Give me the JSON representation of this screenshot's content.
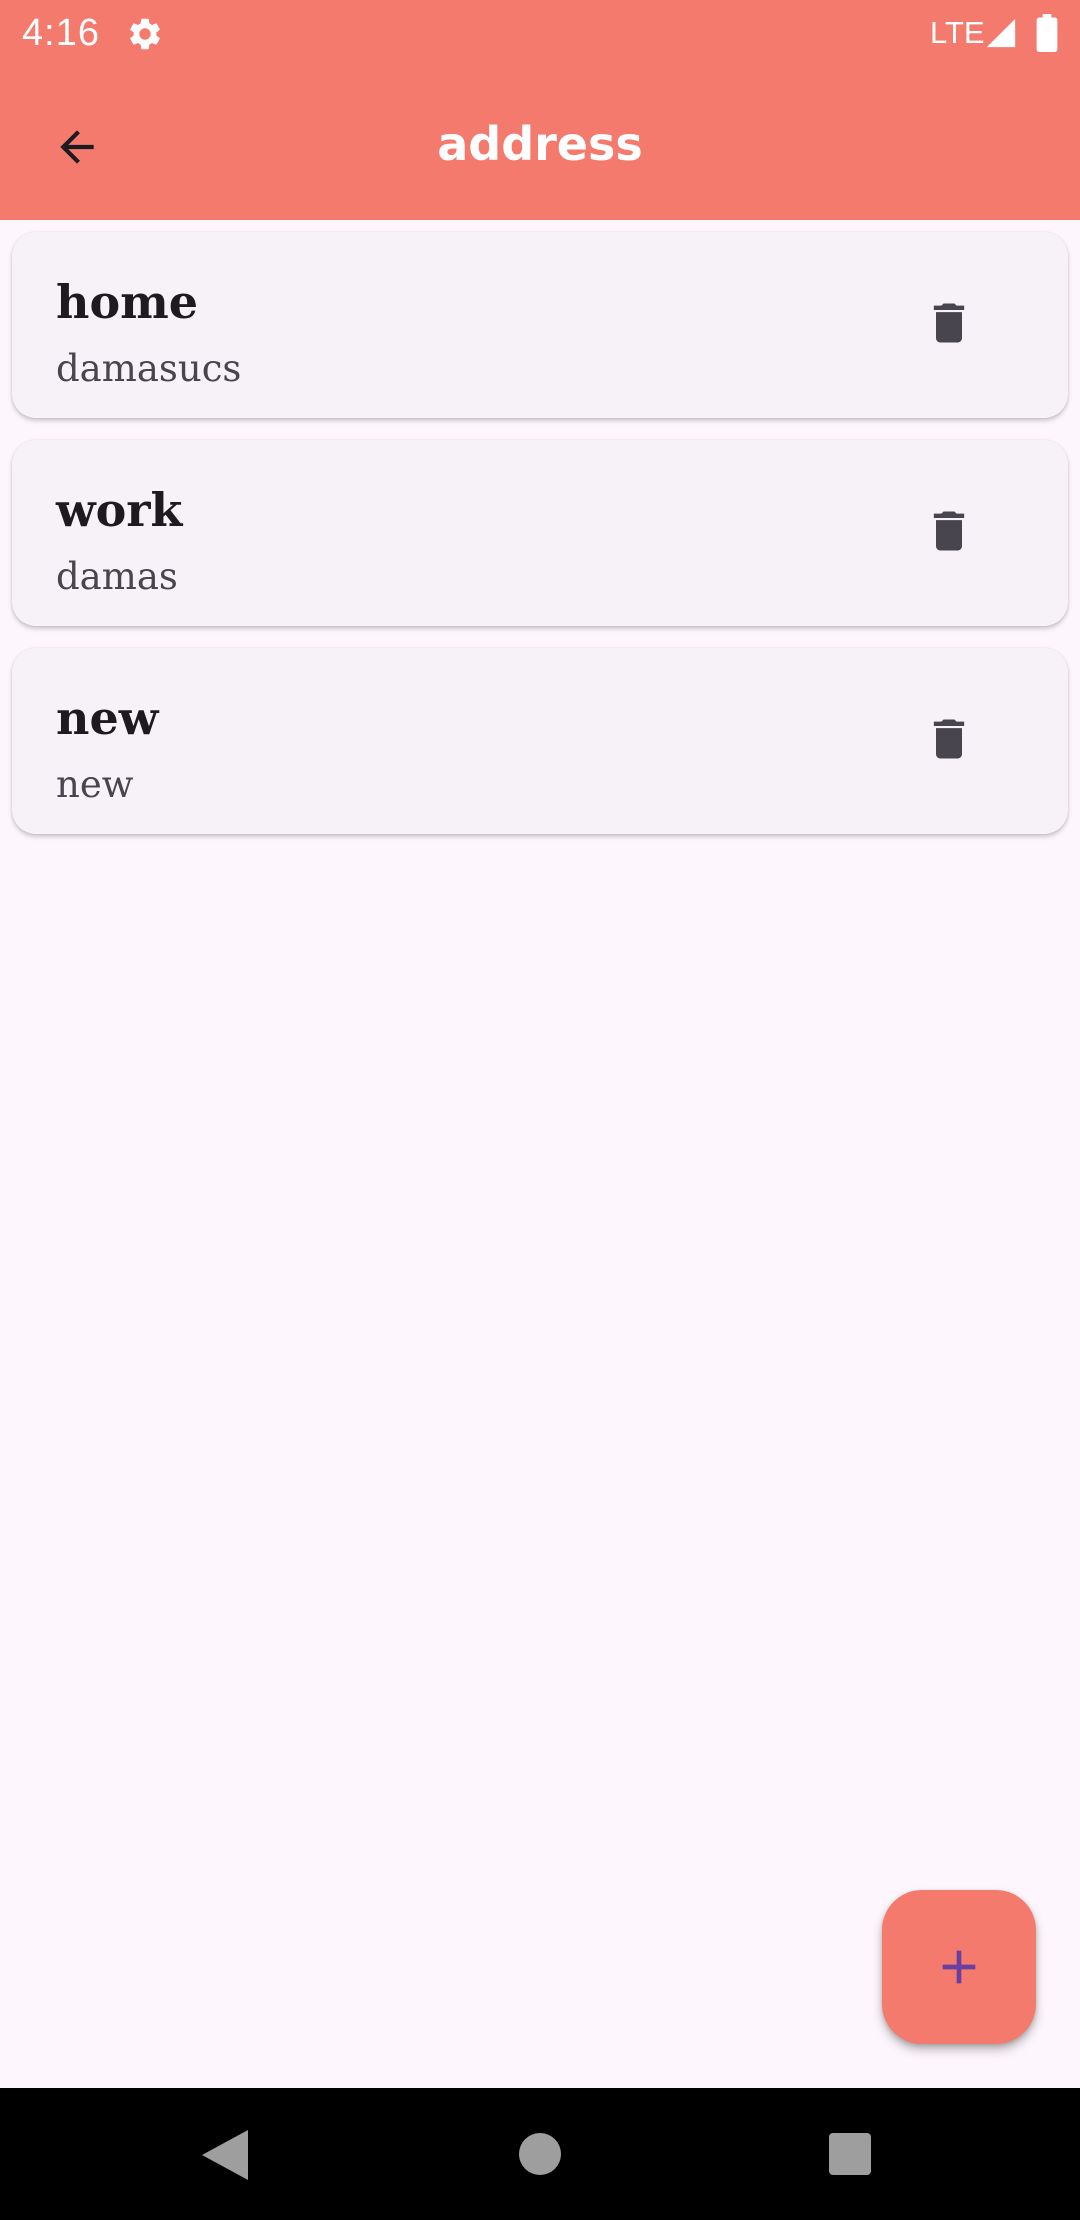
{
  "status_bar": {
    "time": "4:16",
    "network": "LTE",
    "icons": [
      "gear-icon",
      "signal-icon",
      "battery-icon"
    ]
  },
  "app_bar": {
    "title": "address",
    "back_icon": "arrow-back-icon"
  },
  "addresses": [
    {
      "title": "home",
      "subtitle": "damasucs"
    },
    {
      "title": "work",
      "subtitle": "damas"
    },
    {
      "title": "new",
      "subtitle": "new"
    }
  ],
  "fab": {
    "icon": "plus-icon"
  },
  "nav_bar": {
    "icons": [
      "nav-back-icon",
      "nav-home-icon",
      "nav-recents-icon"
    ]
  },
  "colors": {
    "primary": "#F47A6E",
    "background": "#FDF6FC",
    "card": "#F6F2F8",
    "fab_icon": "#6A3FA0",
    "delete_icon": "#49454F"
  }
}
